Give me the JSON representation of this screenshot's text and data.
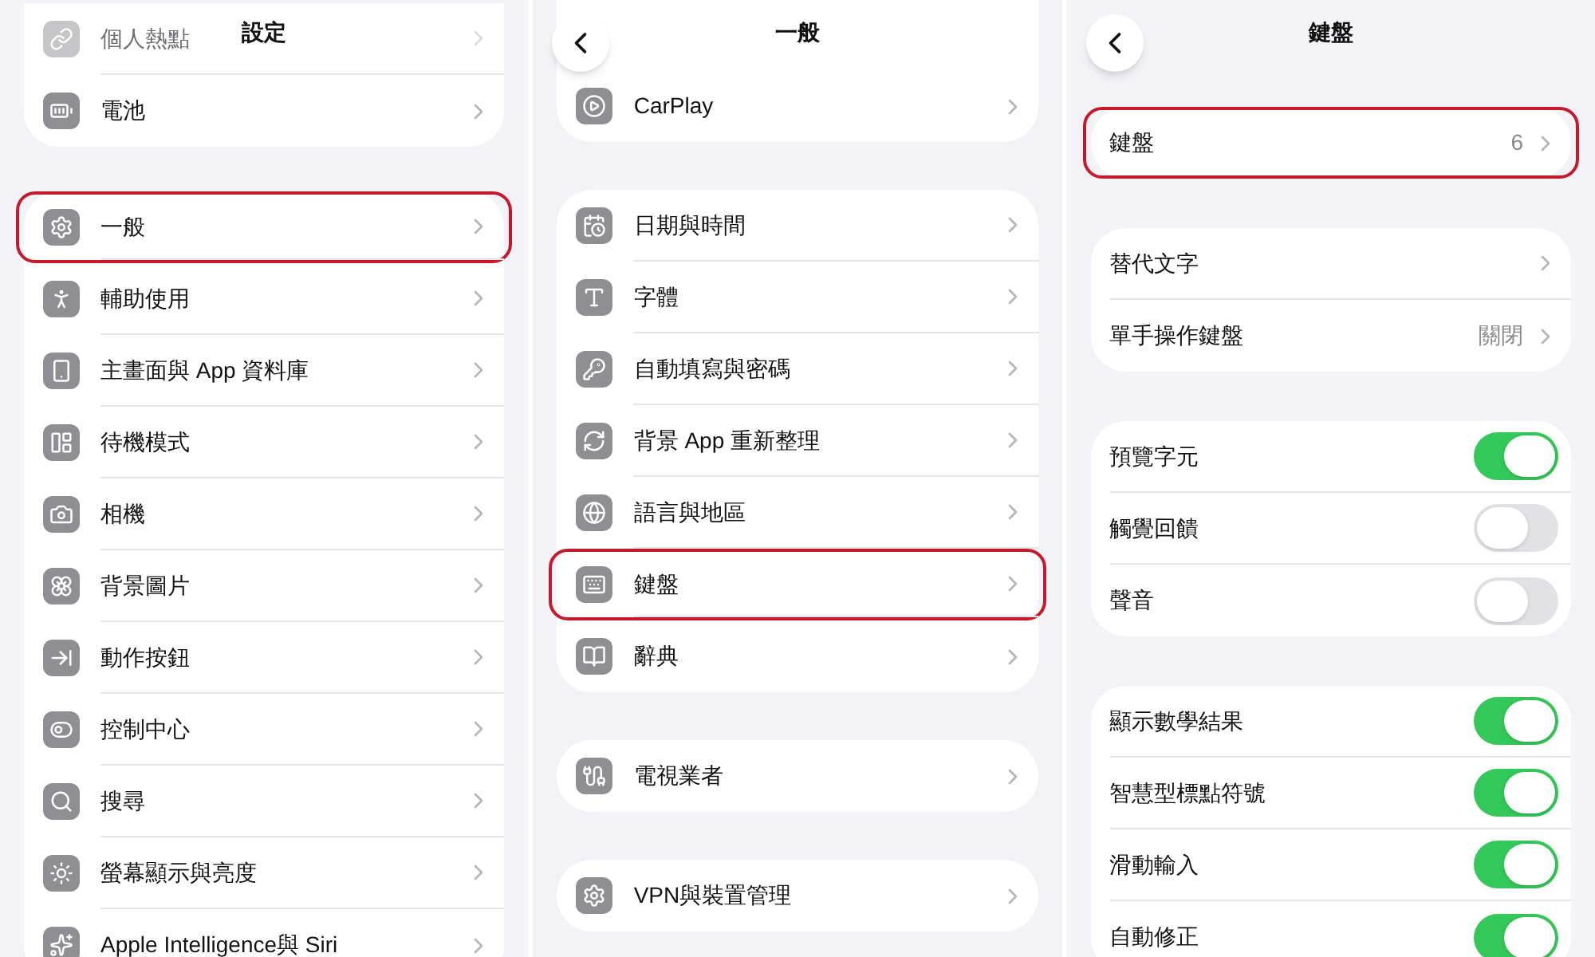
{
  "panels": [
    {
      "title": "設定",
      "groups": [
        {
          "rows": [
            {
              "kind": "link",
              "label": "個人熱點",
              "faded": true,
              "highlighted": false
            },
            {
              "kind": "link",
              "label": "電池",
              "faded": false,
              "highlighted": false
            }
          ]
        },
        {
          "rows": [
            {
              "kind": "link",
              "label": "一般",
              "faded": false,
              "highlighted": true
            },
            {
              "kind": "link",
              "label": "輔助使用",
              "faded": false,
              "highlighted": false
            },
            {
              "kind": "link",
              "label": "主畫面與 App 資料庫",
              "faded": false,
              "highlighted": false
            },
            {
              "kind": "link",
              "label": "待機模式",
              "faded": false,
              "highlighted": false
            },
            {
              "kind": "link",
              "label": "相機",
              "faded": false,
              "highlighted": false
            },
            {
              "kind": "link",
              "label": "背景圖片",
              "faded": false,
              "highlighted": false
            },
            {
              "kind": "link",
              "label": "動作按鈕",
              "faded": false,
              "highlighted": false
            },
            {
              "kind": "link",
              "label": "控制中心",
              "faded": false,
              "highlighted": false
            },
            {
              "kind": "link",
              "label": "搜尋",
              "faded": false,
              "highlighted": false
            },
            {
              "kind": "link",
              "label": "螢幕顯示與亮度",
              "faded": false,
              "highlighted": false
            },
            {
              "kind": "link",
              "label": "Apple Intelligence與 Siri",
              "faded": false,
              "highlighted": false
            }
          ]
        }
      ]
    },
    {
      "title": "一般",
      "back_button": true,
      "groups": [
        {
          "rows": [
            {
              "kind": "link",
              "label": "CarPlay",
              "faded": false,
              "highlighted": false
            }
          ]
        },
        {
          "rows": [
            {
              "kind": "link",
              "label": "日期與時間",
              "faded": false,
              "highlighted": false
            },
            {
              "kind": "link",
              "label": "字體",
              "faded": false,
              "highlighted": false
            },
            {
              "kind": "link",
              "label": "自動填寫與密碼",
              "faded": false,
              "highlighted": false
            },
            {
              "kind": "link",
              "label": "背景 App 重新整理",
              "faded": false,
              "highlighted": false
            },
            {
              "kind": "link",
              "label": "語言與地區",
              "faded": false,
              "highlighted": false
            },
            {
              "kind": "link",
              "label": "鍵盤",
              "faded": false,
              "highlighted": true
            },
            {
              "kind": "link",
              "label": "辭典",
              "faded": false,
              "highlighted": false
            }
          ]
        },
        {
          "rows": [
            {
              "kind": "link",
              "label": "電視業者",
              "faded": false,
              "highlighted": false
            }
          ]
        },
        {
          "rows": [
            {
              "kind": "link",
              "label": "VPN與裝置管理",
              "faded": false,
              "highlighted": false
            }
          ]
        }
      ]
    },
    {
      "title": "鍵盤",
      "back_button": true,
      "groups": [
        {
          "rows": [
            {
              "kind": "link",
              "label": "鍵盤",
              "value": "6",
              "faded": false,
              "highlighted": true
            }
          ]
        },
        {
          "rows": [
            {
              "kind": "link",
              "label": "替代文字",
              "faded": false,
              "highlighted": false
            },
            {
              "kind": "link",
              "label": "單手操作鍵盤",
              "value": "關閉",
              "faded": false,
              "highlighted": false
            }
          ]
        },
        {
          "rows": [
            {
              "kind": "toggle",
              "label": "預覽字元",
              "on": true,
              "faded": false,
              "highlighted": false
            },
            {
              "kind": "toggle",
              "label": "觸覺回饋",
              "on": false,
              "faded": false,
              "highlighted": false
            },
            {
              "kind": "toggle",
              "label": "聲音",
              "on": false,
              "faded": false,
              "highlighted": false
            }
          ]
        },
        {
          "rows": [
            {
              "kind": "toggle",
              "label": "顯示數學結果",
              "on": true,
              "faded": false,
              "highlighted": false
            },
            {
              "kind": "toggle",
              "label": "智慧型標點符號",
              "on": true,
              "faded": false,
              "highlighted": false
            },
            {
              "kind": "toggle",
              "label": "滑動輸入",
              "on": true,
              "faded": false,
              "highlighted": false
            },
            {
              "kind": "toggle",
              "label": "自動修正",
              "on": true,
              "faded": false,
              "highlighted": false
            }
          ]
        }
      ]
    }
  ]
}
